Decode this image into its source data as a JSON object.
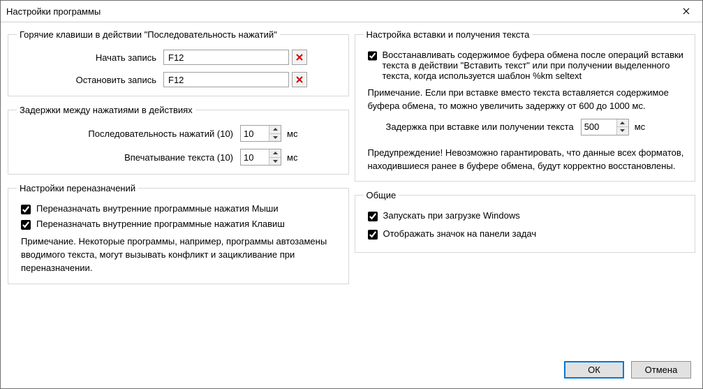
{
  "window": {
    "title": "Настройки программы"
  },
  "hotkeys": {
    "legend": "Горячие клавиши в действии \"Последовательность нажатий\"",
    "start_label": "Начать запись",
    "start_value": "F12",
    "stop_label": "Остановить запись",
    "stop_value": "F12"
  },
  "delays": {
    "legend": "Задержки между нажатиями в действиях",
    "seq_label": "Последовательность нажатий (10)",
    "seq_value": "10",
    "type_label": "Впечатывание текста (10)",
    "type_value": "10",
    "unit": "мс"
  },
  "reassign": {
    "legend": "Настройки переназначений",
    "mouse_label": "Переназначать внутренние программные нажатия Мыши",
    "keys_label": "Переназначать внутренние программные нажатия Клавиш",
    "note": "Примечание. Некоторые программы, например, программы автозамены вводимого текста, могут вызывать конфликт и зацикливание при переназначении."
  },
  "paste": {
    "legend": "Настройка вставки и получения текста",
    "restore_label": "Восстанавливать содержимое буфера обмена после операций вставки текста в действии \"Вставить текст\" или при получении выделенного текста, когда используется шаблон %km seltext",
    "note1": "Примечание. Если при вставке вместо текста вставляется содержимое буфера обмена, то можно увеличить задержку от 600 до 1000 мс.",
    "delay_label": "Задержка при вставке или получении текста",
    "delay_value": "500",
    "delay_unit": "мс",
    "warning": "Предупреждение! Невозможно гарантировать, что данные всех форматов, находившиеся ранее в буфере обмена, будут корректно восстановлены."
  },
  "general": {
    "legend": "Общие",
    "startup_label": "Запускать при загрузке Windows",
    "tray_label": "Отображать значок на панели задач"
  },
  "buttons": {
    "ok": "ОК",
    "cancel": "Отмена"
  }
}
